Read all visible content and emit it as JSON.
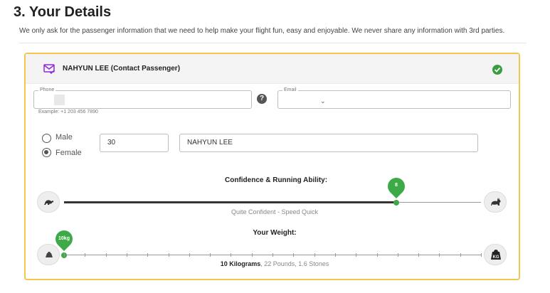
{
  "section": {
    "title": "3. Your Details",
    "description": "We only ask for the passenger information that we need to help make your flight fun, easy and enjoyable. We never share any information with 3rd parties."
  },
  "passenger": {
    "name_label": "NAHYUN LEE (Contact Passenger)",
    "completed": true
  },
  "phone": {
    "legend": "Phone",
    "value": "",
    "example": "Example: +1 203 456 7890"
  },
  "help_icon_glyph": "?",
  "email": {
    "legend": "Email",
    "value": "",
    "visible_mark": "⌄"
  },
  "gender": {
    "options": [
      "Male",
      "Female"
    ],
    "selected": "Female"
  },
  "age": "30",
  "full_name": "NAHYUN LEE",
  "confidence_slider": {
    "title": "Confidence & Running Ability:",
    "value": "8",
    "level_fraction": 0.8,
    "caption": "Quite Confident - Speed Quick",
    "left_icon": "turtle-icon",
    "right_icon": "rabbit-icon"
  },
  "weight_slider": {
    "title": "Your Weight:",
    "value": "10kg",
    "level_fraction": 0,
    "caption_bold": "10 Kilograms",
    "caption_rest": ", 22 Pounds, 1.6 Stones",
    "left_icon": "small-weight-icon",
    "right_icon": "kg-weight-icon"
  },
  "colors": {
    "accent_green": "#3daa47",
    "card_border": "#f3c64d",
    "mail_icon": "#8e2ad8"
  }
}
